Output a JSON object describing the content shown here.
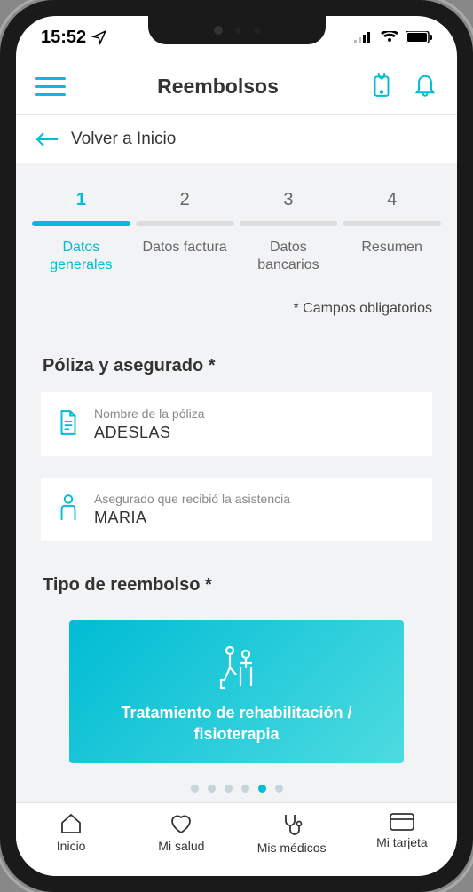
{
  "status": {
    "time": "15:52"
  },
  "header": {
    "title": "Reembolsos"
  },
  "back": {
    "label": "Volver a Inicio"
  },
  "stepper": {
    "steps": [
      {
        "num": "1",
        "label": "Datos generales"
      },
      {
        "num": "2",
        "label": "Datos factura"
      },
      {
        "num": "3",
        "label": "Datos bancarios"
      },
      {
        "num": "4",
        "label": "Resumen"
      }
    ],
    "activeIndex": 0
  },
  "requiredNote": "* Campos obligatorios",
  "sections": {
    "policy": {
      "title": "Póliza y asegurado *",
      "policyField": {
        "label": "Nombre de la póliza",
        "value": "ADESLAS"
      },
      "insuredField": {
        "label": "Asegurado que recibió la asistencia",
        "value": "MARIA"
      }
    },
    "reimbType": {
      "title": "Tipo de reembolso *",
      "card": "Tratamiento de rehabilitación / fisioterapia",
      "activeDot": 4,
      "totalDots": 6
    }
  },
  "bottomNav": {
    "items": [
      {
        "label": "Inicio"
      },
      {
        "label": "Mi salud"
      },
      {
        "label": "Mis médicos"
      },
      {
        "label": "Mi tarjeta"
      }
    ]
  }
}
